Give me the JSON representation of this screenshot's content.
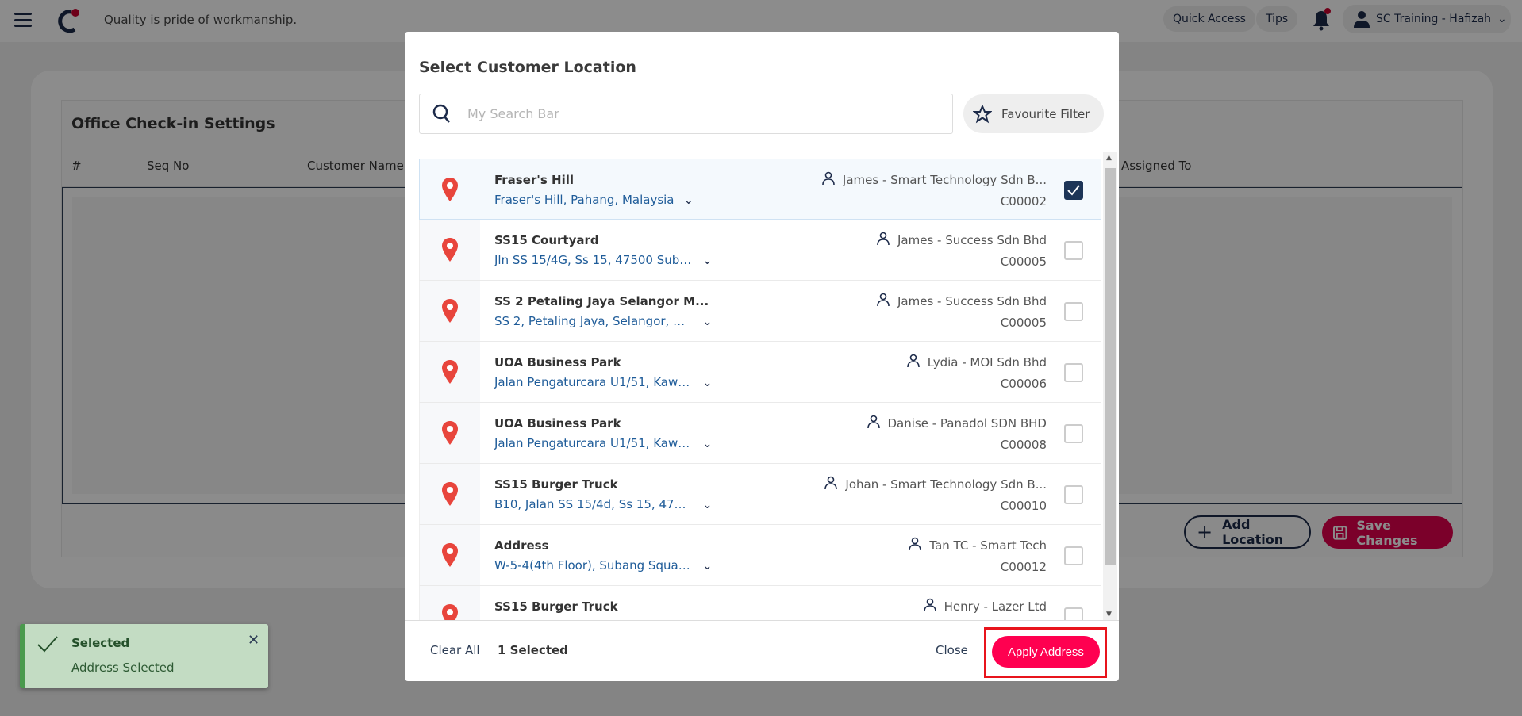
{
  "topbar": {
    "tagline": "Quality is pride of workmanship.",
    "quick_access": "Quick Access",
    "tips": "Tips",
    "user": "SC Training - Hafizah"
  },
  "page": {
    "title": "Office Check-in Settings",
    "columns": [
      "#",
      "Seq No",
      "Customer Name",
      "Assigned To"
    ],
    "add_location": "Add Location",
    "save_changes": "Save Changes"
  },
  "dialog": {
    "title": "Select Customer Location",
    "search_placeholder": "My Search Bar",
    "favourite_filter": "Favourite Filter",
    "rows": [
      {
        "name": "Fraser's Hill",
        "address": "Fraser's Hill, Pahang, Malaysia",
        "assignee": "James - Smart Technology Sdn B...",
        "code": "C00002",
        "checked": true
      },
      {
        "name": "SS15 Courtyard",
        "address": "Jln SS 15/4G, Ss 15, 47500 Suban...",
        "assignee": "James - Success Sdn Bhd",
        "code": "C00005",
        "checked": false
      },
      {
        "name": "SS 2 Petaling Jaya Selangor M...",
        "address": "SS 2, Petaling Jaya, Selangor, Mal...",
        "assignee": "James - Success Sdn Bhd",
        "code": "C00005",
        "checked": false
      },
      {
        "name": "UOA Business Park",
        "address": "Jalan Pengaturcara U1/51, Kawas...",
        "assignee": "Lydia - MOI Sdn Bhd",
        "code": "C00006",
        "checked": false
      },
      {
        "name": "UOA Business Park",
        "address": "Jalan Pengaturcara U1/51, Kawas...",
        "assignee": "Danise - Panadol SDN BHD",
        "code": "C00008",
        "checked": false
      },
      {
        "name": "SS15 Burger Truck",
        "address": "B10, Jalan SS 15/4d, Ss 15, 47500 ...",
        "assignee": "Johan - Smart Technology Sdn B...",
        "code": "C00010",
        "checked": false
      },
      {
        "name": "Address",
        "address": "W-5-4(4th Floor), Subang Squar...",
        "assignee": "Tan TC - Smart Tech",
        "code": "C00012",
        "checked": false
      },
      {
        "name": "SS15 Burger Truck",
        "address": "",
        "assignee": "Henry - Lazer Ltd",
        "code": "",
        "checked": false
      }
    ],
    "clear_all": "Clear All",
    "selected_count": "1 Selected",
    "close": "Close",
    "apply": "Apply Address"
  },
  "toast": {
    "title": "Selected",
    "message": "Address Selected"
  },
  "colors": {
    "accent": "#ff0050",
    "navy": "#1d2b4a",
    "pin": "#e8453c",
    "toast_bg": "#c3dcc3"
  }
}
